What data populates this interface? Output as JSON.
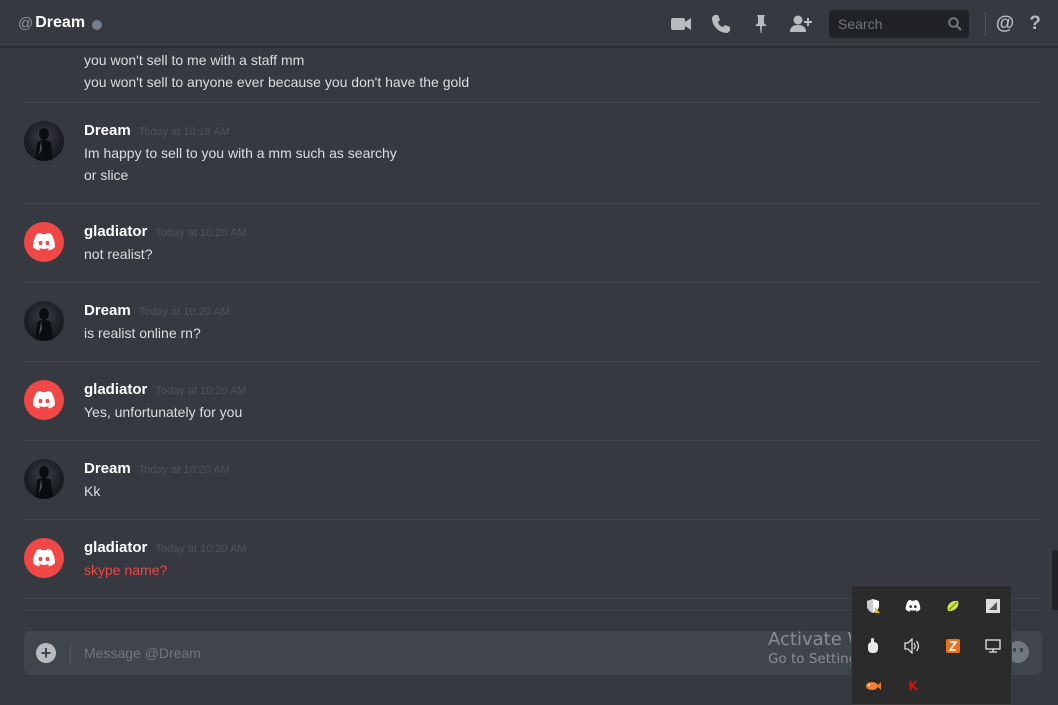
{
  "header": {
    "at_symbol": "@",
    "channel_name": "Dream",
    "search_placeholder": "Search",
    "mention_label": "@",
    "help_label": "?"
  },
  "messages": [
    {
      "author": "",
      "timestamp": "",
      "avatar": "none",
      "lines": [
        "you won't sell to me with a staff mm",
        "you won't sell to anyone ever because you don't have the gold"
      ]
    },
    {
      "author": "Dream",
      "timestamp": "Today at 10:19 AM",
      "avatar": "dream",
      "lines": [
        "Im happy to sell to you with a mm such as searchy",
        "or slice"
      ]
    },
    {
      "author": "gladiator",
      "timestamp": "Today at 10:20 AM",
      "avatar": "discord",
      "lines": [
        "not realist?"
      ]
    },
    {
      "author": "Dream",
      "timestamp": "Today at 10:20 AM",
      "avatar": "dream",
      "lines": [
        "is realist online rn?"
      ]
    },
    {
      "author": "gladiator",
      "timestamp": "Today at 10:20 AM",
      "avatar": "discord",
      "lines": [
        "Yes, unfortunately for you"
      ]
    },
    {
      "author": "Dream",
      "timestamp": "Today at 10:20 AM",
      "avatar": "dream",
      "lines": [
        "Kk"
      ]
    },
    {
      "author": "gladiator",
      "timestamp": "Today at 10:20 AM",
      "avatar": "discord",
      "lines": [
        "skype name?"
      ],
      "failed": true
    }
  ],
  "composer": {
    "plus_label": "+",
    "placeholder": "Message @Dream"
  },
  "watermark": {
    "line1": "Activate Windows",
    "line2": "Go to Settings to activate Windows."
  },
  "tray_icons": [
    "windows-security-icon",
    "discord-icon",
    "lime-app-icon",
    "snipping-app-icon",
    "touch-pointer-icon",
    "volume-icon",
    "orange-app-icon",
    "network-icon",
    "fish-app-icon",
    "kaspersky-icon"
  ],
  "colors": {
    "background": "#36393f",
    "username": "#ffffff",
    "text": "#dcddde",
    "failed_message": "#f04747",
    "discord_avatar": "#f04747"
  }
}
